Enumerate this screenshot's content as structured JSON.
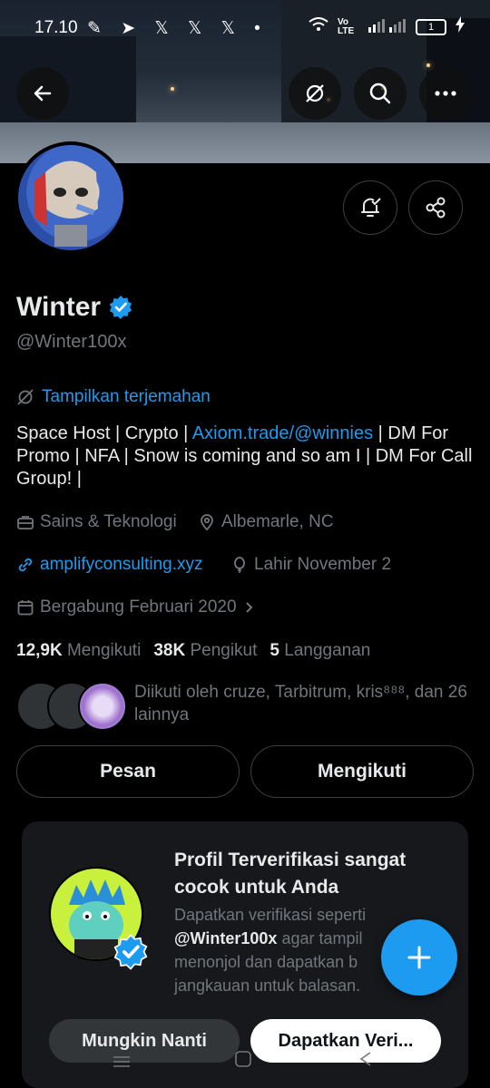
{
  "status_bar": {
    "time": "17.10",
    "notif_icons": "✎ ➤ 𝕏 𝕏 𝕏 •",
    "network": "Vo LTE",
    "battery": "1"
  },
  "profile": {
    "name": "Winter",
    "handle": "@Winter100x",
    "translate": "Tampilkan terjemahan",
    "bio_part1": "Space Host | Crypto | ",
    "bio_link": "Axiom.trade/@winnies",
    "bio_part2": " | DM For Promo | NFA | Snow is coming and so am I | DM For Call Group! |",
    "category": "Sains & Teknologi",
    "location": "Albemarle, NC",
    "website": "amplifyconsulting.xyz",
    "birthday": "Lahir November 2",
    "joined": "Bergabung Februari 2020",
    "following_count": "12,9K",
    "following_label": "Mengikuti",
    "followers_count": "38K",
    "followers_label": "Pengikut",
    "subs_count": "5",
    "subs_label": "Langganan",
    "followed_by": "Diikuti oleh cruze, Tarbitrum, kris⁸⁸⁸, dan 26 lainnya"
  },
  "actions": {
    "message": "Pesan",
    "following": "Mengikuti"
  },
  "promo": {
    "title": "Profil Terverifikasi sangat cocok untuk Anda",
    "desc1": "Dapatkan verifikasi seperti ",
    "desc_handle": "@Winter100x",
    "desc2": " agar tampil menonjol dan dapatkan b jangkauan untuk balasan.",
    "later": "Mungkin Nanti",
    "verify": "Dapatkan Veri..."
  },
  "colors": {
    "accent": "#1d9bf0",
    "bg": "#000000",
    "muted": "#71767b"
  }
}
